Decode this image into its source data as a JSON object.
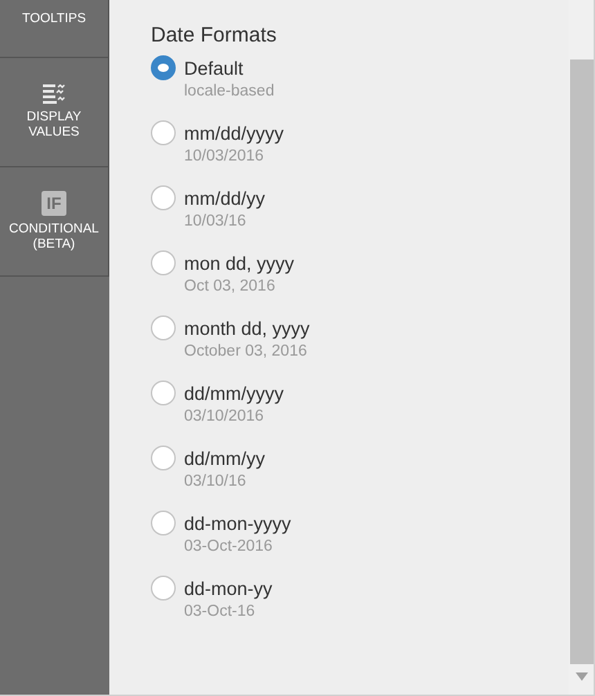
{
  "sidebar": {
    "items": [
      {
        "label": "TOOLTIPS",
        "kind": "plain"
      },
      {
        "label": "DISPLAY VALUES",
        "kind": "drawn"
      },
      {
        "label": "CONDITIONAL (BETA)",
        "kind": "badge",
        "badge": "IF"
      }
    ]
  },
  "panel": {
    "title": "Date Formats",
    "options": [
      {
        "label": "Default",
        "example": "locale-based",
        "selected": true
      },
      {
        "label": "mm/dd/yyyy",
        "example": "10/03/2016",
        "selected": false
      },
      {
        "label": "mm/dd/yy",
        "example": "10/03/16",
        "selected": false
      },
      {
        "label": "mon dd, yyyy",
        "example": "Oct 03, 2016",
        "selected": false
      },
      {
        "label": "month dd, yyyy",
        "example": "October 03, 2016",
        "selected": false
      },
      {
        "label": "dd/mm/yyyy",
        "example": "03/10/2016",
        "selected": false
      },
      {
        "label": "dd/mm/yy",
        "example": "03/10/16",
        "selected": false
      },
      {
        "label": "dd-mon-yyyy",
        "example": "03-Oct-2016",
        "selected": false
      },
      {
        "label": "dd-mon-yy",
        "example": "03-Oct-16",
        "selected": false
      }
    ]
  }
}
